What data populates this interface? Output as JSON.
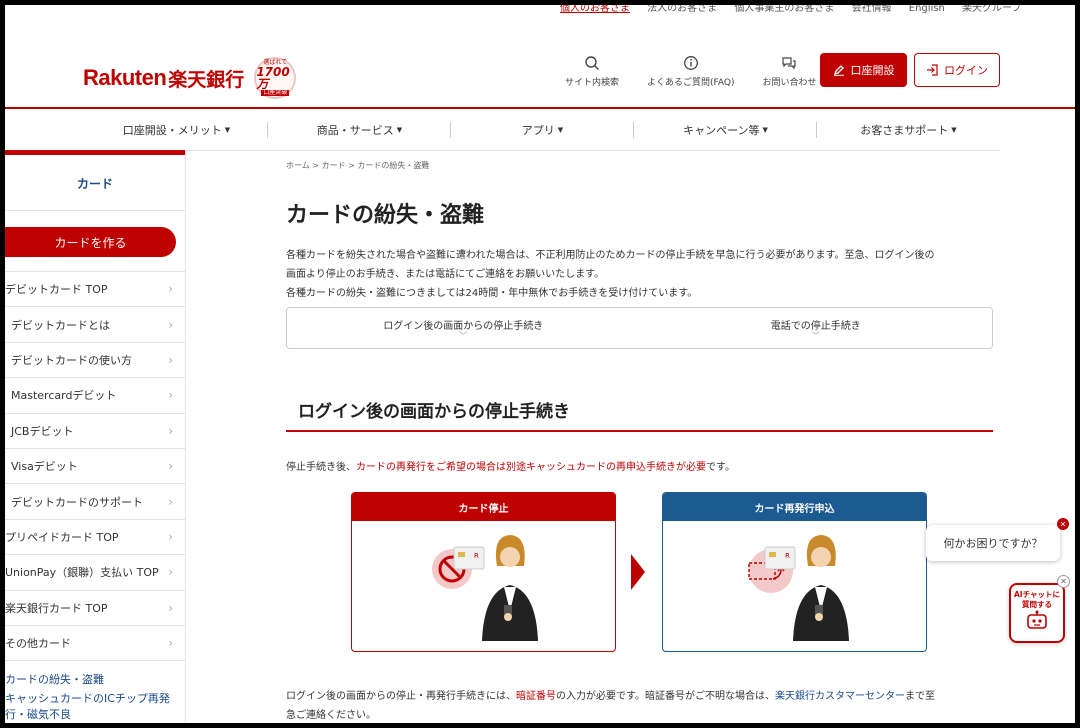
{
  "util_links": [
    "個人のお客さま",
    "法人のお客さま",
    "個人事業主のお客さま",
    "会社情報",
    "English",
    "楽天グループ"
  ],
  "header": {
    "logo_en": "Rakuten",
    "logo_jp": "楽天銀行",
    "badge_top": "選ばれて",
    "badge_num": "1700万",
    "badge_bottom": "口座突破",
    "icons": [
      {
        "label": "サイト内検索",
        "icon": "search-icon"
      },
      {
        "label": "よくあるご質問(FAQ)",
        "icon": "info-icon"
      },
      {
        "label": "お問い合わせ",
        "icon": "chat-icon"
      }
    ],
    "open_account": "口座開設",
    "login": "ログイン"
  },
  "gnav": [
    "口座開設・メリット",
    "商品・サービス",
    "アプリ",
    "キャンペーン等",
    "お客さまサポート"
  ],
  "sidebar": {
    "title": "カード",
    "make_card": "カードを作る",
    "items": [
      {
        "label": "デビットカード TOP",
        "indent": false
      },
      {
        "label": "デビットカードとは",
        "indent": true
      },
      {
        "label": "デビットカードの使い方",
        "indent": true
      },
      {
        "label": "Mastercardデビット",
        "indent": true
      },
      {
        "label": "JCBデビット",
        "indent": true
      },
      {
        "label": "Visaデビット",
        "indent": true
      },
      {
        "label": "デビットカードのサポート",
        "indent": true
      },
      {
        "label": "プリペイドカード TOP",
        "indent": false
      },
      {
        "label": "UnionPay（銀聯）支払い TOP",
        "indent": false
      },
      {
        "label": "楽天銀行カード TOP",
        "indent": false
      },
      {
        "label": "その他カード",
        "indent": false
      }
    ],
    "current": "カードの紛失・盗難",
    "next": "キャッシュカードのICチップ再発行・磁気不良"
  },
  "main": {
    "breadcrumb": "ホーム > カード > カードの紛失・盗難",
    "title": "カードの紛失・盗難",
    "lead_1": "各種カードを紛失された場合や盗難に遭われた場合は、不正利用防止のためカードの停止手続を早急に行う必要があります。至急、ログイン後の",
    "lead_2": "画面より停止のお手続き、または電話にてご連絡をお願いいたします。",
    "lead_3": "各種カードの紛失・盗難につきましては24時間・年中無休でお手続きを受け付けています。",
    "anchor_1": "ログイン後の画面からの停止手続き",
    "anchor_2": "電話での停止手続き",
    "section_title": "ログイン後の画面からの停止手続き",
    "note_pre": "停止手続き後、",
    "note_red": "カードの再発行をご希望の場合は別途キャッシュカードの再申込手続きが必要",
    "note_post": "です。",
    "card_1": "カード停止",
    "card_2": "カード再発行申込",
    "bottom_pre": "ログイン後の画面からの停止・再発行手続きには、",
    "bottom_red": "暗証番号",
    "bottom_mid": "の入力が必要です。暗証番号がご不明な場合は、",
    "bottom_blue": "楽天銀行カスタマーセンター",
    "bottom_post": "まで至",
    "bottom_2": "急ご連絡ください。"
  },
  "chat": {
    "bubble": "何かお困りですか？",
    "ai_line1": "AIチャットに",
    "ai_line2": "質問する"
  },
  "colors": {
    "brand_red": "#bf0000",
    "brand_blue": "#1c5a92",
    "link_blue": "#1a4a8a"
  }
}
